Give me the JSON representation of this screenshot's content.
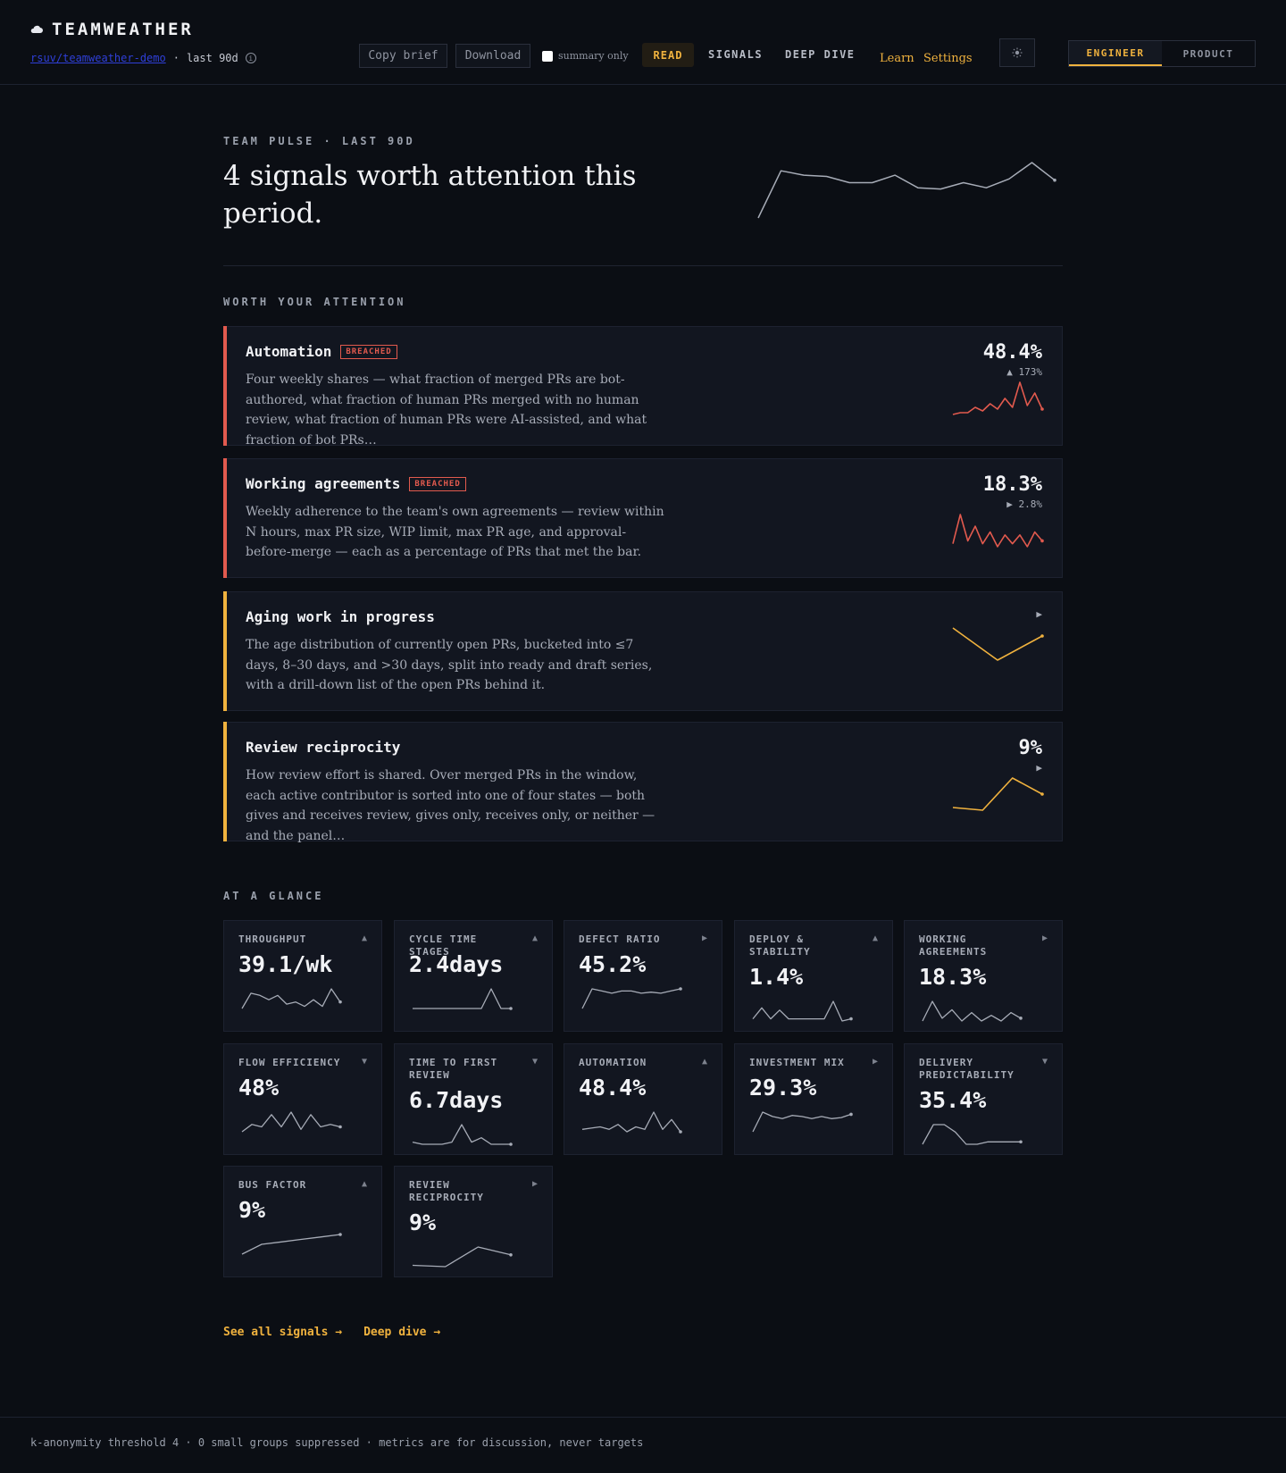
{
  "app": {
    "name": "TEAMWEATHER",
    "repo": "rsuv/teamweather-demo",
    "window": "last 90d"
  },
  "toolbar": {
    "copy_brief": "Copy brief",
    "download": "Download",
    "summary_only": "summary only",
    "summary_only_checked": false
  },
  "nav": {
    "read": "READ",
    "signals": "SIGNALS",
    "deep_dive": "DEEP DIVE",
    "learn": "Learn",
    "settings": "Settings",
    "roles": [
      "ENGINEER",
      "PRODUCT"
    ],
    "active_role": "ENGINEER"
  },
  "hero": {
    "eyebrow": "TEAM PULSE · LAST 90D",
    "title": "4 signals worth attention this period.",
    "spark": [
      20,
      95,
      88,
      86,
      76,
      76,
      88,
      68,
      66,
      76,
      68,
      82,
      108,
      80
    ]
  },
  "attention": {
    "heading": "WORTH YOUR ATTENTION",
    "cards": [
      {
        "title": "Automation",
        "badge": "BREACHED",
        "description": "Four weekly shares — what fraction of merged PRs are bot-authored, what fraction of human PRs merged with no human review, what fraction of human PRs were AI-assisted, and what fraction of bot PRs…",
        "value": "48.4%",
        "delta": "▲ 173%",
        "tone": "#e25a4e",
        "spark": [
          20,
          22,
          22,
          28,
          24,
          32,
          26,
          38,
          28,
          56,
          30,
          44,
          26
        ]
      },
      {
        "title": "Working agreements",
        "badge": "BREACHED",
        "description": "Weekly adherence to the team's own agreements — review within N hours, max PR size, WIP limit, max PR age, and approval-before-merge — each as a percentage of PRs that met the bar.",
        "value": "18.3%",
        "delta": "▶ 2.8%",
        "tone": "#e25a4e",
        "spark": [
          28,
          48,
          30,
          40,
          28,
          36,
          26,
          34,
          28,
          34,
          26,
          36,
          30
        ]
      },
      {
        "title": "Aging work in progress",
        "badge": "",
        "description": "The age distribution of currently open PRs, bucketed into ≤7 days, 8–30 days, and >30 days, split into ready and draft series, with a drill-down list of the open PRs behind it.",
        "value": "",
        "delta": "▶",
        "tone": "#f0b23e",
        "spark": [
          40,
          16,
          34
        ]
      },
      {
        "title": "Review reciprocity",
        "badge": "",
        "description": "How review effort is shared. Over merged PRs in the window, each active contributor is sorted into one of four states — both gives and receives review, gives only, receives only, or neither — and the panel…",
        "value": "9%",
        "delta": "▶",
        "tone": "#f0b23e",
        "spark": [
          18,
          16,
          40,
          28
        ]
      }
    ]
  },
  "glance": {
    "heading": "AT A GLANCE",
    "tiles": [
      {
        "label": "THROUGHPUT",
        "arrow": "▲",
        "value": "39.1/wk",
        "spark": [
          16,
          30,
          28,
          24,
          28,
          20,
          22,
          18,
          24,
          18,
          34,
          22
        ]
      },
      {
        "label": "CYCLE TIME STAGES",
        "arrow": "▲",
        "value": "2.4days",
        "spark": [
          10,
          10,
          10,
          10,
          10,
          10,
          10,
          10,
          30,
          10,
          10
        ]
      },
      {
        "label": "DEFECT RATIO",
        "arrow": "▶",
        "value": "45.2%",
        "spark": [
          10,
          28,
          26,
          24,
          26,
          26,
          24,
          25,
          24,
          26,
          28
        ]
      },
      {
        "label": "DEPLOY & STABILITY",
        "arrow": "▲",
        "value": "1.4%",
        "spark": [
          16,
          26,
          16,
          24,
          16,
          16,
          16,
          16,
          16,
          32,
          14,
          16
        ]
      },
      {
        "label": "WORKING AGREEMENTS",
        "arrow": "▶",
        "value": "18.3%",
        "spark": [
          16,
          30,
          18,
          24,
          16,
          22,
          16,
          20,
          16,
          22,
          18
        ]
      },
      {
        "label": "FLOW EFFICIENCY",
        "arrow": "▼",
        "value": "48%",
        "spark": [
          14,
          20,
          18,
          28,
          18,
          30,
          16,
          28,
          18,
          20,
          18
        ]
      },
      {
        "label": "TIME TO FIRST REVIEW",
        "arrow": "▼",
        "value": "6.7days",
        "spark": [
          14,
          12,
          12,
          12,
          14,
          30,
          14,
          18,
          12,
          12,
          12
        ]
      },
      {
        "label": "AUTOMATION",
        "arrow": "▲",
        "value": "48.4%",
        "spark": [
          16,
          17,
          18,
          16,
          20,
          14,
          18,
          16,
          30,
          16,
          24,
          14
        ]
      },
      {
        "label": "INVESTMENT MIX",
        "arrow": "▶",
        "value": "29.3%",
        "spark": [
          10,
          28,
          24,
          22,
          25,
          24,
          22,
          24,
          22,
          23,
          26
        ]
      },
      {
        "label": "DELIVERY PREDICTABILITY",
        "arrow": "▼",
        "value": "35.4%",
        "spark": [
          10,
          26,
          26,
          20,
          10,
          10,
          12,
          12,
          12,
          12
        ]
      },
      {
        "label": "BUS FACTOR",
        "arrow": "▲",
        "value": "9%",
        "spark": [
          10,
          18,
          20,
          22,
          24,
          26
        ]
      },
      {
        "label": "REVIEW RECIPROCITY",
        "arrow": "▶",
        "value": "9%",
        "spark": [
          12,
          11,
          26,
          20
        ]
      }
    ]
  },
  "links": {
    "see_all": "See all signals →",
    "deep_dive": "Deep dive →"
  },
  "footer": {
    "text": "k-anonymity threshold 4 · 0 small groups suppressed · metrics are for discussion, never targets"
  },
  "colors": {
    "accent": "#f0b23e",
    "breach": "#e25a4e",
    "muted_line": "#a7acb7"
  }
}
